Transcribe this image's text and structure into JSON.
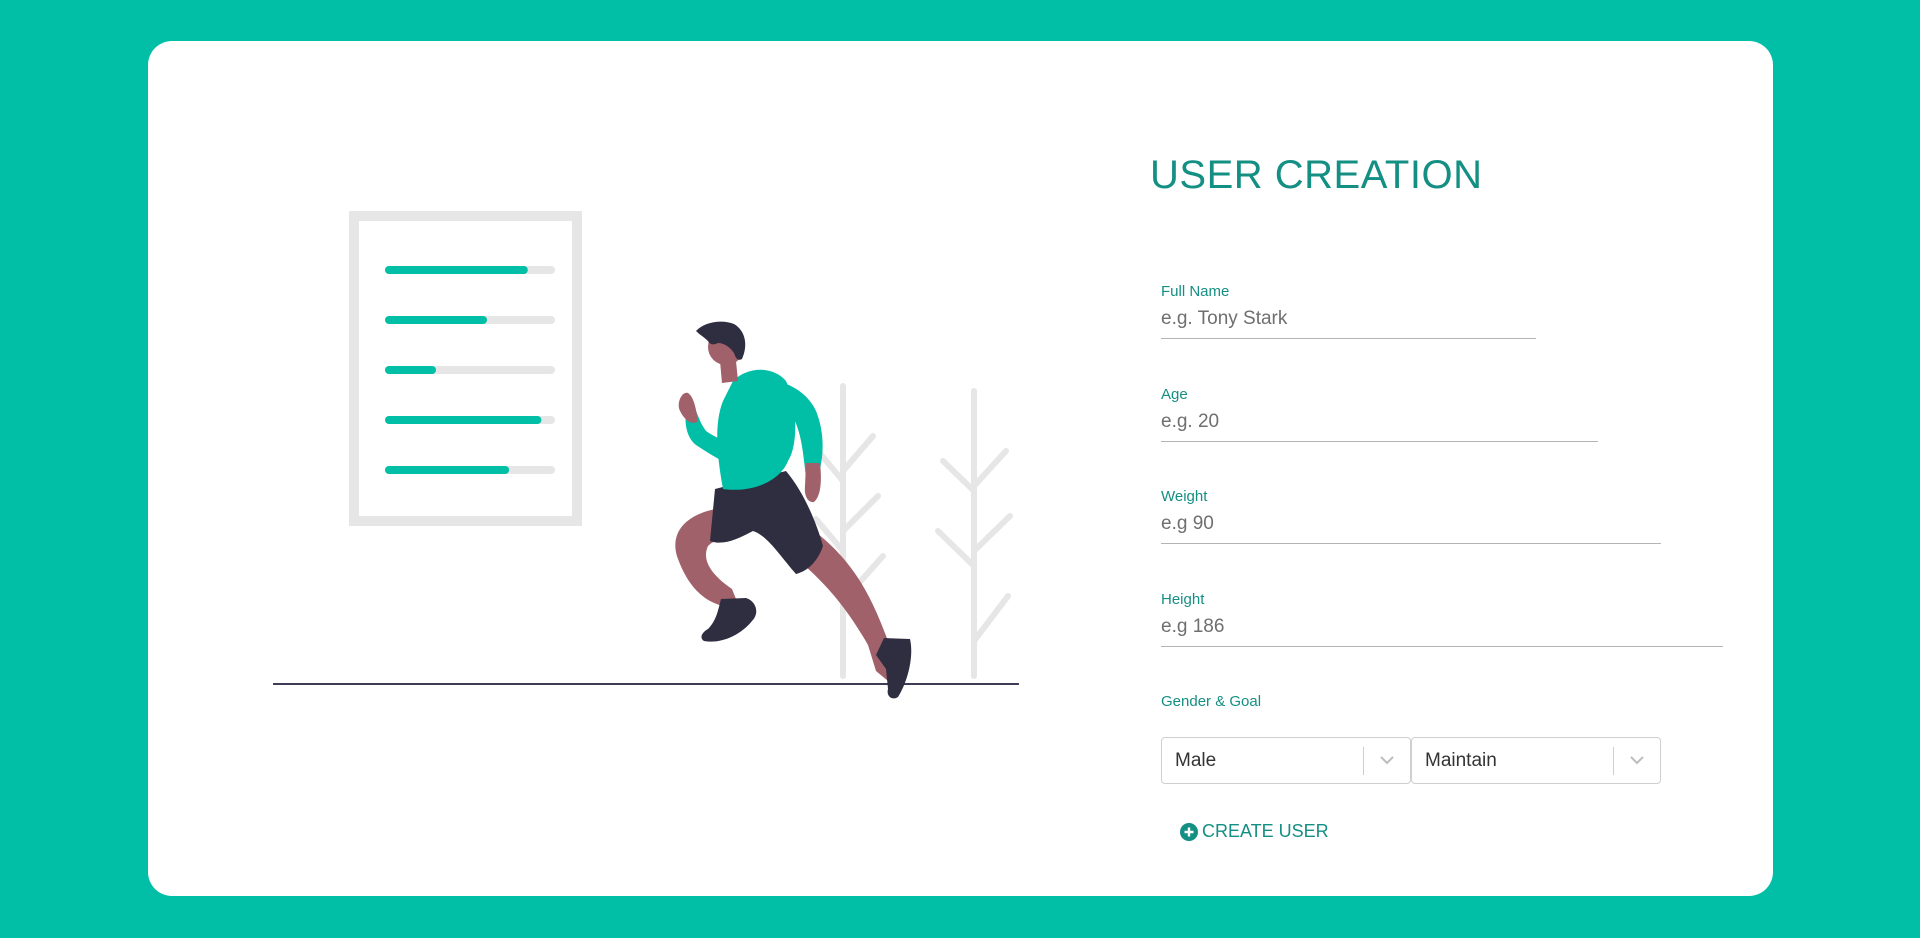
{
  "form": {
    "title": "USER CREATION",
    "fields": [
      {
        "label": "Full Name",
        "placeholder": "e.g. Tony Stark"
      },
      {
        "label": "Age",
        "placeholder": "e.g. 20"
      },
      {
        "label": "Weight",
        "placeholder": "e.g 90"
      },
      {
        "label": "Height",
        "placeholder": "e.g 186"
      }
    ],
    "selects_label": "Gender & Goal",
    "gender": {
      "value": "Male"
    },
    "goal": {
      "value": "Maintain"
    },
    "submit_label": "CREATE USER"
  },
  "colors": {
    "background": "#00bfa6",
    "accent": "#148f83",
    "card": "#ffffff",
    "figure_shirt": "#00bfa6",
    "figure_skin": "#a0616a",
    "figure_dark": "#2f2e41"
  },
  "icons": {
    "submit": "plus-circle-icon",
    "select_arrow": "chevron-down-icon"
  },
  "illustration": {
    "progress_bars": [
      0.84,
      0.6,
      0.3,
      0.92,
      0.73
    ]
  }
}
